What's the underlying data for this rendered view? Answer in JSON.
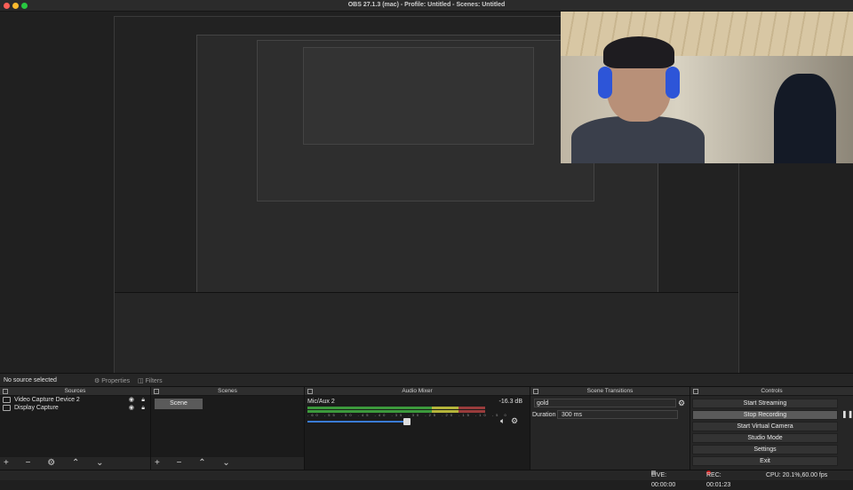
{
  "window": {
    "title": "OBS 27.1.3 (mac) - Profile: Untitled - Scenes: Untitled"
  },
  "colors": {
    "close": "#ff5f57",
    "minimize": "#febc2e",
    "zoom": "#28c840",
    "meter_green": "#3c9a3c",
    "slider_blue": "#3a7bd5"
  },
  "source_bar": {
    "status": "No source selected",
    "properties": "Properties",
    "filters": "Filters"
  },
  "sources": {
    "header": "Sources",
    "items": [
      {
        "label": "Video Capture Device 2",
        "icon": "camera-icon"
      },
      {
        "label": "Display Capture",
        "icon": "monitor-icon"
      }
    ],
    "tools": "+ − ⚙ ⌃ ⌄"
  },
  "scenes": {
    "header": "Scenes",
    "items": [
      {
        "label": "Scene"
      }
    ],
    "tools": "+ − ⌃ ⌄"
  },
  "mixer": {
    "header": "Audio Mixer",
    "channel": "Mic/Aux 2",
    "level": "-16.3 dB",
    "ticks": "-60 -55 -50 -45 -40 -35 -30 -25 -20 -15 -10 -5 0",
    "meter_fill": 0.85,
    "volume": 0.5
  },
  "transitions": {
    "header": "Scene Transitions",
    "selected": "gold",
    "duration_label": "Duration",
    "duration": "300 ms"
  },
  "controls": {
    "header": "Controls",
    "buttons": [
      "Start Streaming",
      "Stop Recording",
      "Start Virtual Camera",
      "Studio Mode",
      "Settings",
      "Exit"
    ]
  },
  "status": {
    "live": "LIVE: 00:00:00",
    "rec": "REC: 00:01:23",
    "cpu": "CPU: 20.1%,60.00 fps"
  }
}
